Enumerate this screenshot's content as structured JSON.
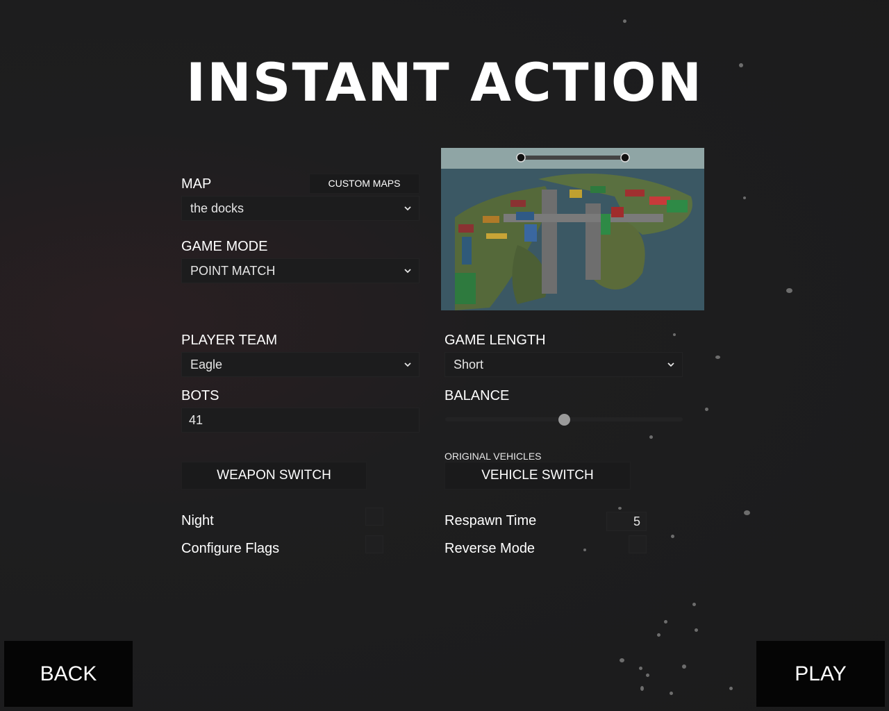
{
  "title": "INSTANT ACTION",
  "map": {
    "label": "MAP",
    "custom_maps_label": "CUSTOM MAPS",
    "selected": "the docks"
  },
  "game_mode": {
    "label": "GAME MODE",
    "selected": "POINT MATCH"
  },
  "player_team": {
    "label": "PLAYER TEAM",
    "selected": "Eagle"
  },
  "game_length": {
    "label": "GAME LENGTH",
    "selected": "Short"
  },
  "bots": {
    "label": "BOTS",
    "value": "41"
  },
  "balance": {
    "label": "BALANCE",
    "value_fraction": 0.5
  },
  "weapon_switch": {
    "label": "WEAPON SWITCH"
  },
  "vehicle": {
    "caption": "ORIGINAL VEHICLES",
    "label": "VEHICLE SWITCH"
  },
  "options": {
    "night_label": "Night",
    "configure_flags_label": "Configure Flags",
    "respawn_time_label": "Respawn Time",
    "respawn_time_value": "5",
    "reverse_mode_label": "Reverse Mode"
  },
  "footer": {
    "back_label": "BACK",
    "play_label": "PLAY"
  },
  "colors": {
    "background": "#1c1c1d",
    "field": "#1c1c1d",
    "text": "#ffffff",
    "slider_thumb": "#9a9a9a"
  },
  "icons": {
    "dropdown": "chevron-down-icon"
  }
}
